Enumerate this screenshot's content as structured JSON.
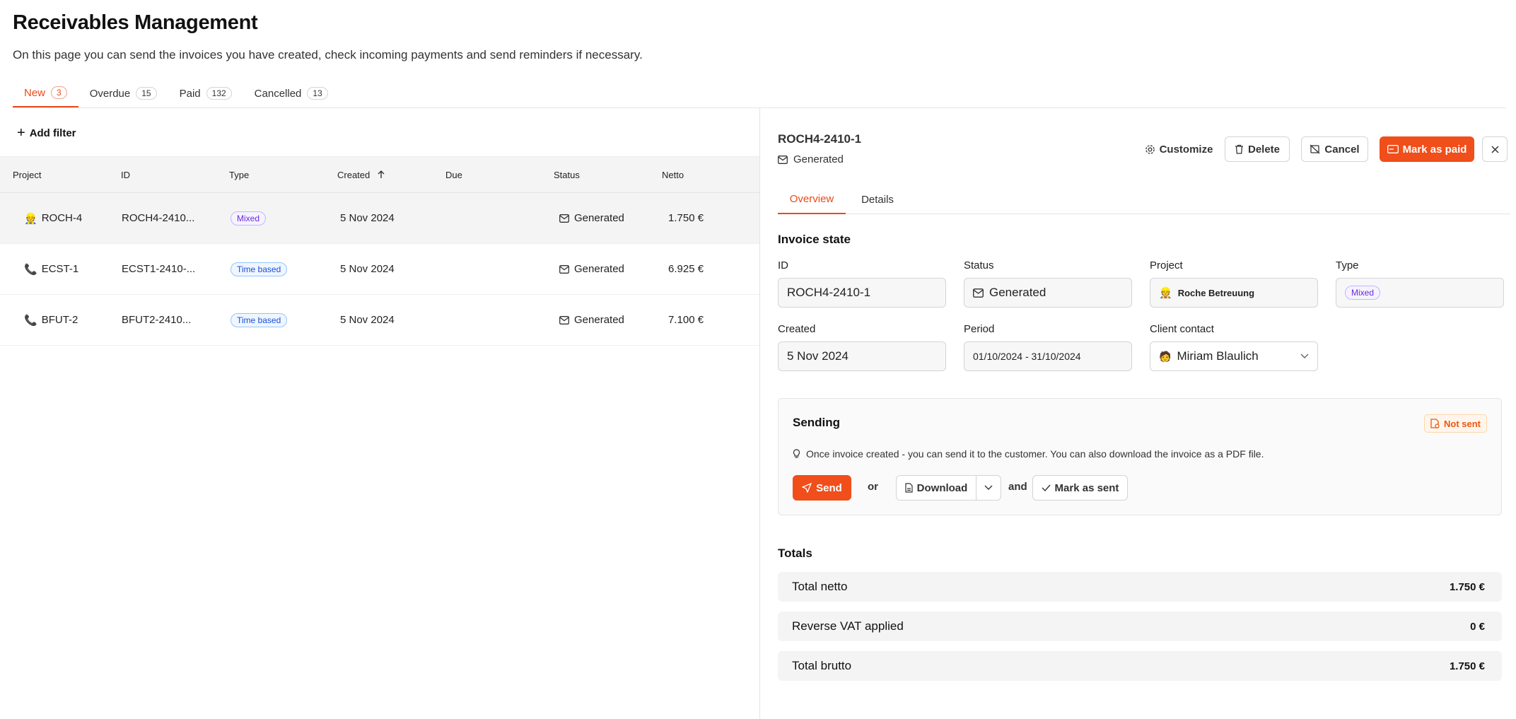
{
  "page": {
    "title": "Receivables Management",
    "subtitle": "On this page you can send the invoices you have created, check incoming payments and send reminders if necessary."
  },
  "tabs": [
    {
      "label": "New",
      "count": "3"
    },
    {
      "label": "Overdue",
      "count": "15"
    },
    {
      "label": "Paid",
      "count": "132"
    },
    {
      "label": "Cancelled",
      "count": "13"
    }
  ],
  "filter": {
    "add_label": "Add filter"
  },
  "table": {
    "columns": [
      "Project",
      "ID",
      "Type",
      "Created",
      "Due",
      "Status",
      "Netto"
    ],
    "rows": [
      {
        "project": "ROCH-4",
        "project_icon": "person-icon",
        "id": "ROCH4-2410...",
        "type": "Mixed",
        "created": "5 Nov 2024",
        "due": "",
        "status": "Generated",
        "netto": "1.750 €"
      },
      {
        "project": "ECST-1",
        "project_icon": "phone-icon",
        "id": "ECST1-2410-...",
        "type": "Time based",
        "created": "5 Nov 2024",
        "due": "",
        "status": "Generated",
        "netto": "6.925 €"
      },
      {
        "project": "BFUT-2",
        "project_icon": "phone-icon",
        "id": "BFUT2-2410...",
        "type": "Time based",
        "created": "5 Nov 2024",
        "due": "",
        "status": "Generated",
        "netto": "7.100 €"
      }
    ]
  },
  "detail": {
    "title": "ROCH4-2410-1",
    "status": "Generated",
    "buttons": {
      "customize": "Customize",
      "delete": "Delete",
      "cancel": "Cancel",
      "mark_paid": "Mark as paid"
    },
    "tabs": [
      "Overview",
      "Details"
    ],
    "invoice_state": {
      "heading": "Invoice state",
      "id_label": "ID",
      "id_value": "ROCH4-2410-1",
      "status_label": "Status",
      "status_value": "Generated",
      "project_label": "Project",
      "project_value": "Roche Betreuung",
      "type_label": "Type",
      "type_value": "Mixed",
      "created_label": "Created",
      "created_value": "5 Nov 2024",
      "period_label": "Period",
      "period_value": "01/10/2024 - 31/10/2024",
      "contact_label": "Client contact",
      "contact_value": "Miriam Blaulich"
    },
    "sending": {
      "heading": "Sending",
      "badge": "Not sent",
      "hint": "Once invoice created - you can send it to the customer. You can also download the invoice as a PDF file.",
      "send": "Send",
      "or": "or",
      "download": "Download",
      "and": "and",
      "mark_sent": "Mark as sent"
    },
    "totals": {
      "heading": "Totals",
      "rows": [
        {
          "label": "Total netto",
          "value": "1.750 €"
        },
        {
          "label": "Reverse VAT applied",
          "value": "0 €"
        },
        {
          "label": "Total brutto",
          "value": "1.750 €"
        }
      ]
    }
  },
  "colors": {
    "accent": "#f04e1a",
    "mixed": "#6d28d9",
    "time_based": "#1d4ed8"
  }
}
